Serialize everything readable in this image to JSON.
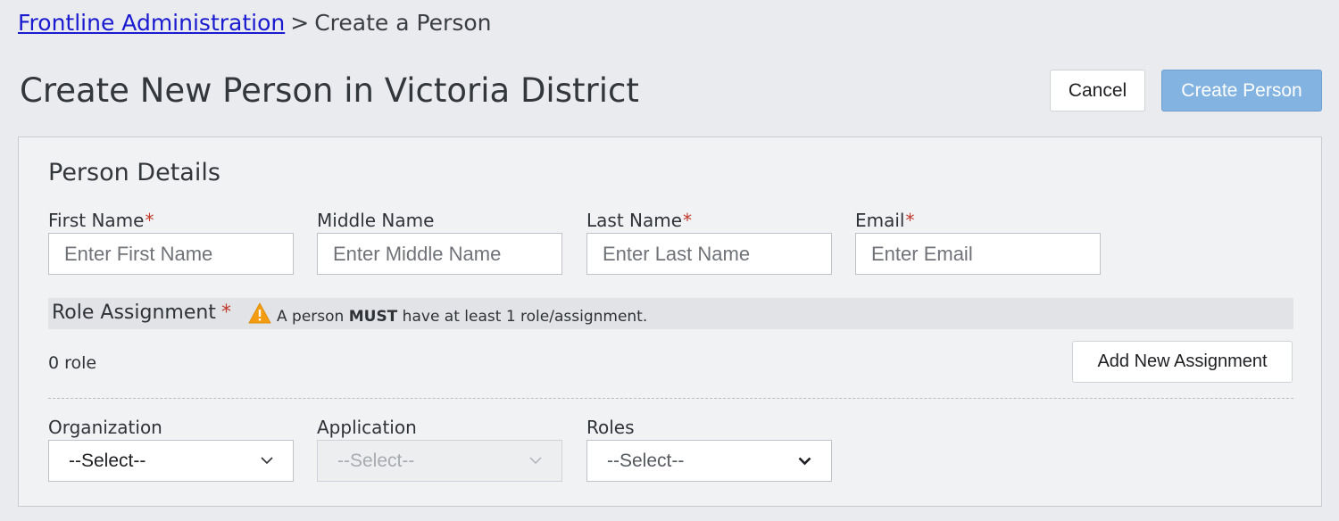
{
  "breadcrumb": {
    "link": "Frontline Administration",
    "separator": ">",
    "current": "Create a Person"
  },
  "header": {
    "title": "Create New Person in Victoria District",
    "cancel_label": "Cancel",
    "create_label": "Create Person"
  },
  "person_details": {
    "title": "Person Details",
    "required_mark": "*",
    "fields": [
      {
        "label": "First Name",
        "required": true,
        "placeholder": "Enter First Name",
        "value": ""
      },
      {
        "label": "Middle Name",
        "required": false,
        "placeholder": "Enter Middle Name",
        "value": ""
      },
      {
        "label": "Last Name",
        "required": true,
        "placeholder": "Enter Last Name",
        "value": ""
      },
      {
        "label": "Email",
        "required": true,
        "placeholder": "Enter Email",
        "value": ""
      }
    ]
  },
  "role_assignment": {
    "title": "Role Assignment",
    "required_mark": "*",
    "warning_icon": "warning-triangle-icon",
    "warning_prefix": "A person ",
    "warning_emphasis": "MUST",
    "warning_suffix": " have at least 1 role/assignment.",
    "count_text": "0 role",
    "add_label": "Add New Assignment"
  },
  "assignment_form": {
    "organization": {
      "label": "Organization",
      "value": "--Select--",
      "disabled": false
    },
    "application": {
      "label": "Application",
      "value": "--Select--",
      "disabled": true
    },
    "roles": {
      "label": "Roles",
      "value": "--Select--",
      "disabled": false
    }
  },
  "colors": {
    "link": "#1a1ad0",
    "primary_button": "#83b3e0",
    "required": "#c0392b",
    "warning": "#f39c12"
  }
}
